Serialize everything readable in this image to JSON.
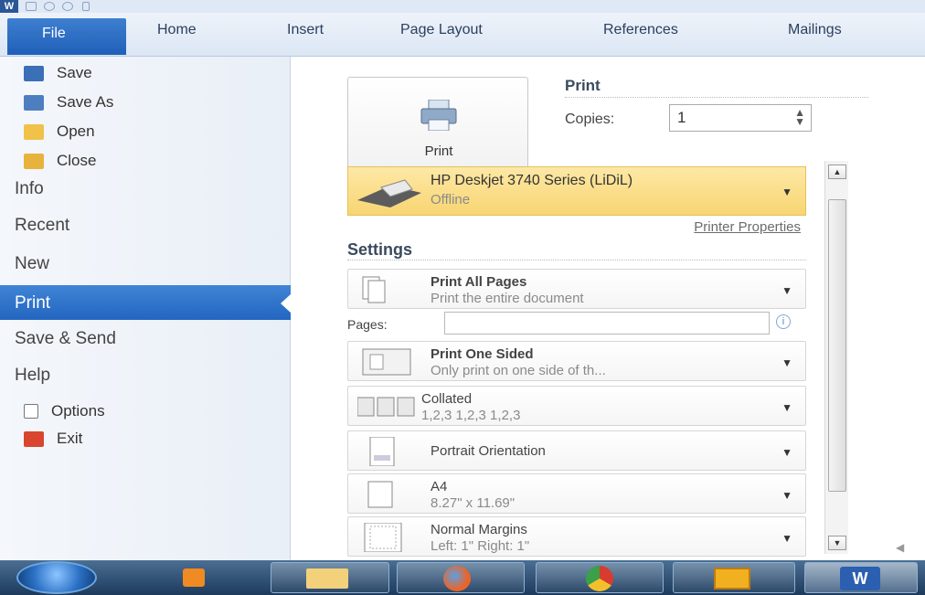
{
  "ribbon": {
    "app_icon": "W",
    "file_tab": "File",
    "tabs": [
      "Home",
      "Insert",
      "Page Layout",
      "References",
      "Mailings"
    ]
  },
  "nav": {
    "small_items": [
      {
        "label": "Save",
        "icon": "save-icon"
      },
      {
        "label": "Save As",
        "icon": "save-as-icon"
      },
      {
        "label": "Open",
        "icon": "open-folder-icon"
      },
      {
        "label": "Close",
        "icon": "close-folder-icon"
      }
    ],
    "info": "Info",
    "recent": "Recent",
    "new": "New",
    "print": "Print",
    "save_send": "Save & Send",
    "help": "Help",
    "options": "Options",
    "exit": "Exit"
  },
  "print": {
    "button_label": "Print",
    "section_title": "Print",
    "copies_label": "Copies:",
    "copies_value": "1",
    "printer_name": "HP Deskjet 3740 Series (LiDiL)",
    "printer_status": "Offline",
    "printer_properties": "Printer Properties",
    "settings_title": "Settings",
    "pages_label": "Pages:",
    "pages_value": "",
    "options": [
      {
        "title": "Print All Pages",
        "subtitle": "Print the entire document"
      },
      {
        "title": "Print One Sided",
        "subtitle": "Only print on one side of th..."
      },
      {
        "title": "Collated",
        "subtitle": "1,2,3   1,2,3   1,2,3"
      },
      {
        "title": "Portrait Orientation",
        "subtitle": ""
      },
      {
        "title": "A4",
        "subtitle": "8.27\" x 11.69\""
      },
      {
        "title": "Normal Margins",
        "subtitle": "Left: 1\"   Right: 1\""
      }
    ]
  },
  "taskbar": {
    "apps": [
      "start-orb",
      "media-player-icon",
      "file-explorer-icon",
      "firefox-icon",
      "chrome-icon",
      "video-app-icon",
      "word-icon"
    ]
  },
  "colors": {
    "file_tab": "#2a6ac4",
    "selected_nav": "#2d72cc",
    "printer_highlight": "#fbdc84",
    "taskbar": "#2f4e72"
  }
}
